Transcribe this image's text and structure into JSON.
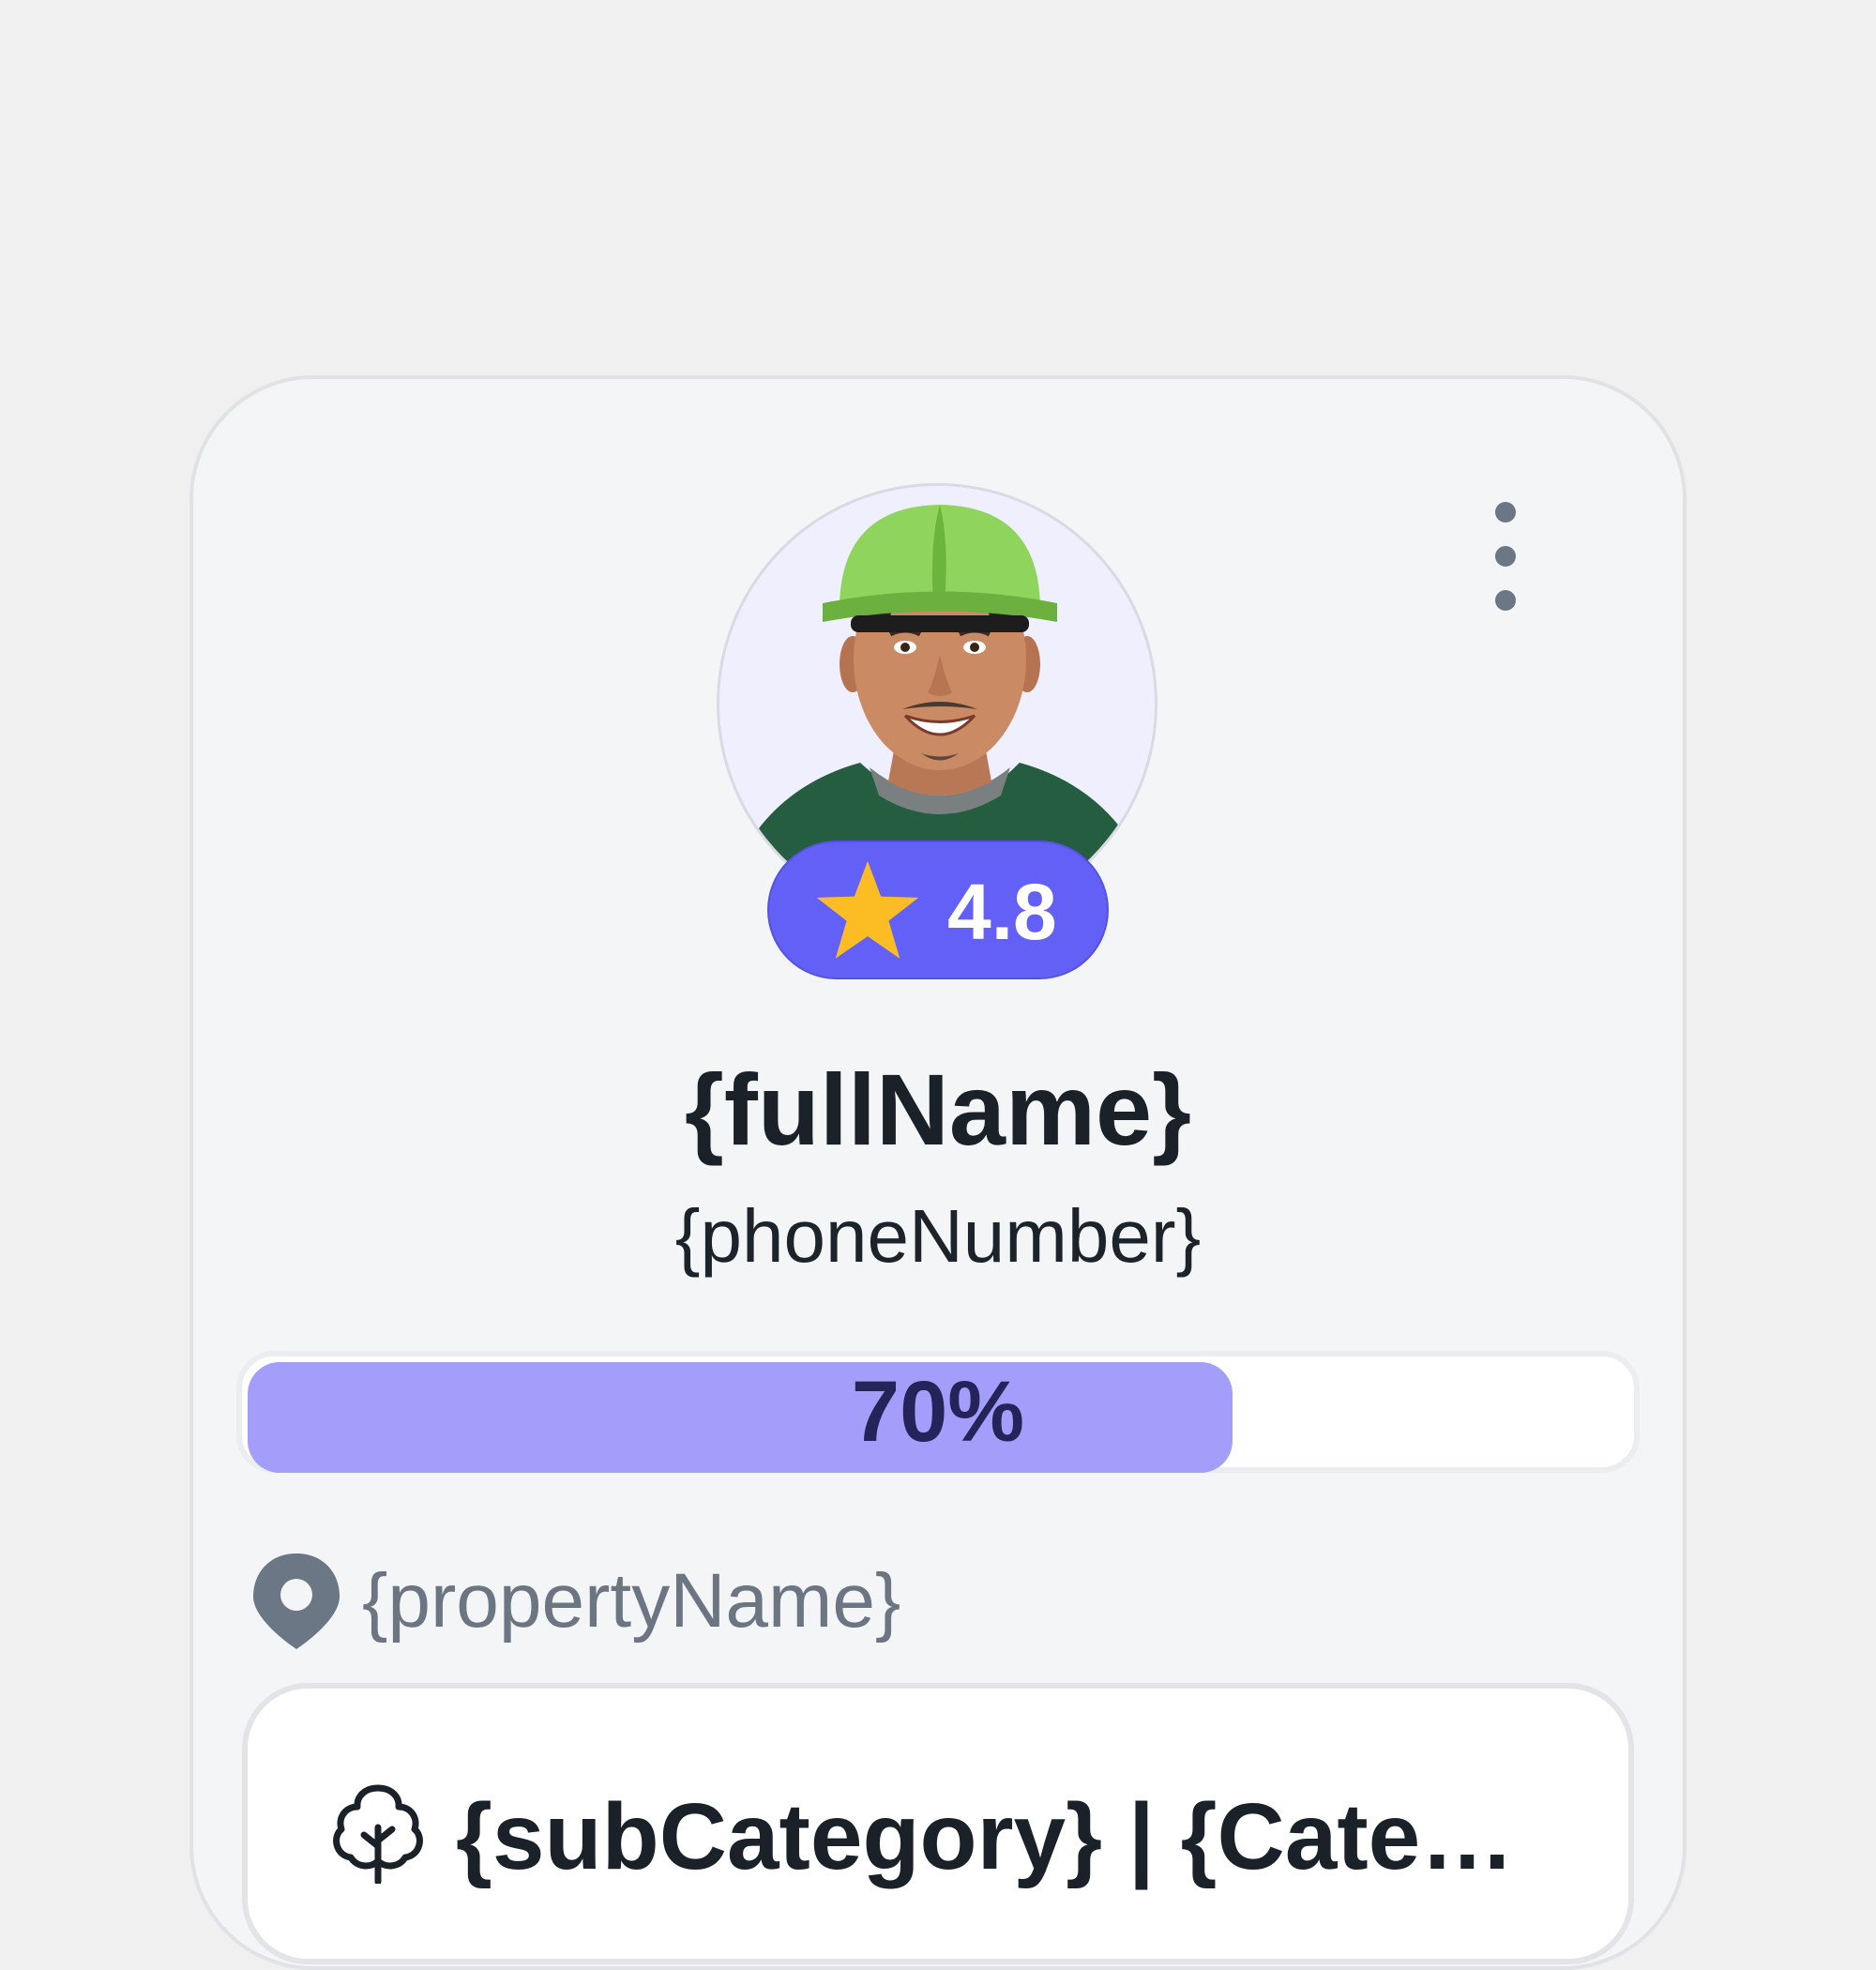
{
  "profile": {
    "full_name": "{fullName}",
    "phone_number": "{phoneNumber}",
    "rating": "4.8",
    "avatar_icon": "worker-photo-icon"
  },
  "progress": {
    "label": "70%",
    "value": 0.7
  },
  "property": {
    "name": "{propertyName}",
    "icon": "location-pin-icon"
  },
  "category": {
    "text": "{subCategory} | {Category}",
    "icon": "tree-icon"
  },
  "menu": {
    "icon": "more-vertical-icon"
  },
  "colors": {
    "accent": "#6360f7",
    "progress_fill": "#a29ef9",
    "star": "#fbbd23",
    "text_dark": "#1a2129",
    "text_muted": "#6b7682"
  }
}
